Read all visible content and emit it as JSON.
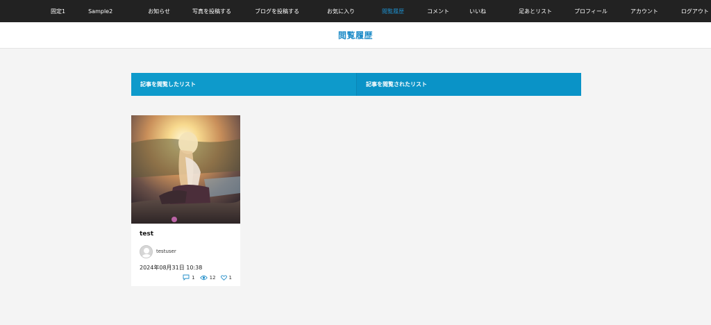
{
  "nav": {
    "items": [
      {
        "label": "固定1",
        "active": false
      },
      {
        "label": "Sample2",
        "active": false
      },
      {
        "label": "お知らせ",
        "active": false
      },
      {
        "label": "写真を投稿する",
        "active": false
      },
      {
        "label": "ブログを投稿する",
        "active": false
      },
      {
        "label": "お気に入り",
        "active": false
      },
      {
        "label": "閲覧履歴",
        "active": true
      },
      {
        "label": "コメント",
        "active": false
      },
      {
        "label": "いいね",
        "active": false
      },
      {
        "label": "足あとリスト",
        "active": false
      },
      {
        "label": "プロフィール",
        "active": false
      },
      {
        "label": "アカウント",
        "active": false
      },
      {
        "label": "ログアウト",
        "active": false
      }
    ]
  },
  "page": {
    "title": "閲覧履歴"
  },
  "tabs": {
    "viewed": "記事を閲覧したリスト",
    "viewed_by": "記事を閲覧されたリスト"
  },
  "card": {
    "title": "test",
    "author": "testuser",
    "date": "2024年08月31日 10:38",
    "comments": "1",
    "views": "12",
    "likes": "1",
    "image_icon": "photo-thumbnail"
  },
  "colors": {
    "accent": "#1e8cc8",
    "tab_bg": "#0e9acb",
    "nav_bg": "#222222"
  }
}
